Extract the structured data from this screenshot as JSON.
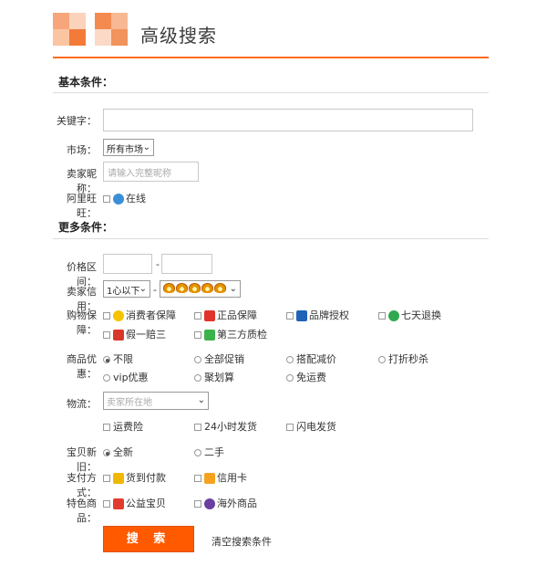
{
  "page": {
    "title": "高级搜索"
  },
  "colors": {
    "accent": "#ff5a00",
    "divider": "#dcdcdc"
  },
  "basic": {
    "heading": "基本条件：",
    "keyword_label": "关键字：",
    "keyword_value": "",
    "market_label": "市场：",
    "market_value": "所有市场",
    "seller_nick_label": "卖家昵称：",
    "seller_nick_placeholder": "请输入完整昵称",
    "wangwang_label": "阿里旺旺：",
    "wangwang_online": "在线"
  },
  "more": {
    "heading": "更多条件：",
    "price_label": "价格区间：",
    "price_separator": "-",
    "price_min": "",
    "price_max": "",
    "credit_label": "卖家信用：",
    "credit_min": "1心以下",
    "credit_separator": "-",
    "credit_max_icon": "crown-icons",
    "guarantee_label": "购物保障：",
    "guarantees": [
      {
        "label": "消费者保障",
        "icon": "consumer-protection-icon"
      },
      {
        "label": "正品保障",
        "icon": "genuine-guarantee-icon"
      },
      {
        "label": "品牌授权",
        "icon": "brand-authorization-icon"
      },
      {
        "label": "七天退换",
        "icon": "seven-day-return-icon"
      },
      {
        "label": "假一赔三",
        "icon": "fake-compensation-icon"
      },
      {
        "label": "第三方质检",
        "icon": "third-party-inspection-icon"
      }
    ],
    "promo_label": "商品优惠：",
    "promos": [
      {
        "label": "不限",
        "selected": true
      },
      {
        "label": "全部促销",
        "selected": false
      },
      {
        "label": "搭配减价",
        "selected": false
      },
      {
        "label": "打折秒杀",
        "selected": false
      },
      {
        "label": "vip优惠",
        "selected": false
      },
      {
        "label": "聚划算",
        "selected": false
      },
      {
        "label": "免运费",
        "selected": false
      }
    ],
    "logistics_label": "物流：",
    "logistics_placeholder": "卖家所在地",
    "logistics_options": [
      {
        "label": "运费险"
      },
      {
        "label": "24小时发货"
      },
      {
        "label": "闪电发货"
      }
    ],
    "condition_label": "宝贝新旧：",
    "conditions": [
      {
        "label": "全新",
        "selected": true
      },
      {
        "label": "二手",
        "selected": false
      }
    ],
    "payment_label": "支付方式：",
    "payments": [
      {
        "label": "货到付款",
        "icon": "cash-on-delivery-icon"
      },
      {
        "label": "信用卡",
        "icon": "credit-card-icon"
      }
    ],
    "special_label": "特色商品：",
    "specials": [
      {
        "label": "公益宝贝",
        "icon": "charity-icon"
      },
      {
        "label": "海外商品",
        "icon": "overseas-icon"
      }
    ]
  },
  "actions": {
    "search_label": "搜 索",
    "clear_label": "清空搜索条件"
  }
}
